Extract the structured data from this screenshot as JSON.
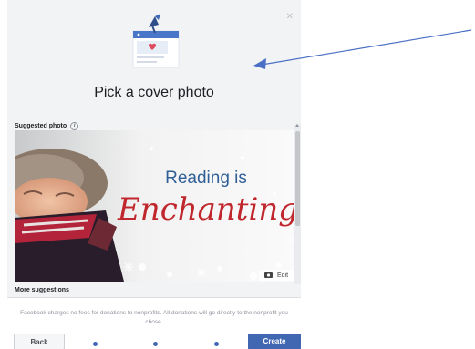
{
  "dialog": {
    "title": "Pick a cover photo",
    "close_icon": "close-icon",
    "suggested_label": "Suggested photo",
    "info_glyph": "i",
    "more_label": "More suggestions"
  },
  "cover_photo": {
    "line1": "Reading is",
    "line2": "Enchanting",
    "edit_label": "Edit"
  },
  "footer": {
    "disclaimer": "Facebook charges no fees for donations to nonprofits. All donations will go directly to the nonprofit you chose.",
    "back_label": "Back",
    "create_label": "Create",
    "progress_steps": 3
  },
  "colors": {
    "accent": "#4267b2",
    "dialog_bg": "#f2f3f5",
    "brand_red": "#c0272d"
  }
}
